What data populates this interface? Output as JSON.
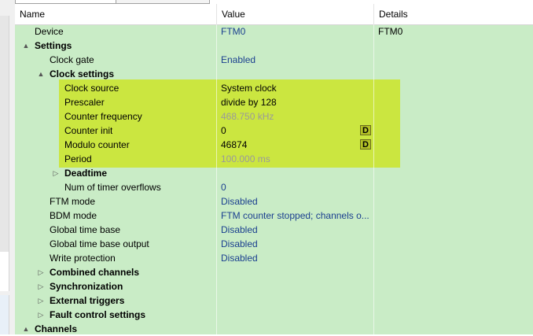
{
  "header": {
    "name": "Name",
    "value": "Value",
    "details": "Details"
  },
  "rows": [
    {
      "name": "Device",
      "value": "FTM0",
      "details": "FTM0"
    },
    {
      "name": "Settings",
      "value": "",
      "expander": "▲"
    },
    {
      "name": "Clock gate",
      "value": "Enabled"
    },
    {
      "name": "Clock settings",
      "value": "",
      "expander": "▲"
    },
    {
      "name": "Clock source",
      "value": "System clock"
    },
    {
      "name": "Prescaler",
      "value": "divide by 128"
    },
    {
      "name": "Counter frequency",
      "value": "468.750 kHz"
    },
    {
      "name": "Counter init",
      "value": "0",
      "button": "D"
    },
    {
      "name": "Modulo counter",
      "value": "46874",
      "button": "D"
    },
    {
      "name": "Period",
      "value": "100.000 ms"
    },
    {
      "name": "Deadtime",
      "value": "",
      "expander": "▷"
    },
    {
      "name": "Num of timer overflows",
      "value": "0"
    },
    {
      "name": "FTM mode",
      "value": "Disabled"
    },
    {
      "name": "BDM mode",
      "value": "FTM counter stopped; channels o..."
    },
    {
      "name": "Global time base",
      "value": "Disabled"
    },
    {
      "name": "Global time base output",
      "value": "Disabled"
    },
    {
      "name": "Write protection",
      "value": "Disabled"
    },
    {
      "name": "Combined channels",
      "value": "",
      "expander": "▷"
    },
    {
      "name": "Synchronization",
      "value": "",
      "expander": "▷"
    },
    {
      "name": "External triggers",
      "value": "",
      "expander": "▷"
    },
    {
      "name": "Fault control settings",
      "value": "",
      "expander": "▷"
    },
    {
      "name": "Channels",
      "value": "",
      "expander": "▲"
    }
  ],
  "colors": {
    "grid_bg": "#c9ecc6",
    "highlight": "#cbe640",
    "value_text": "#1a3f8f",
    "readonly_text": "#9a9a9a"
  }
}
